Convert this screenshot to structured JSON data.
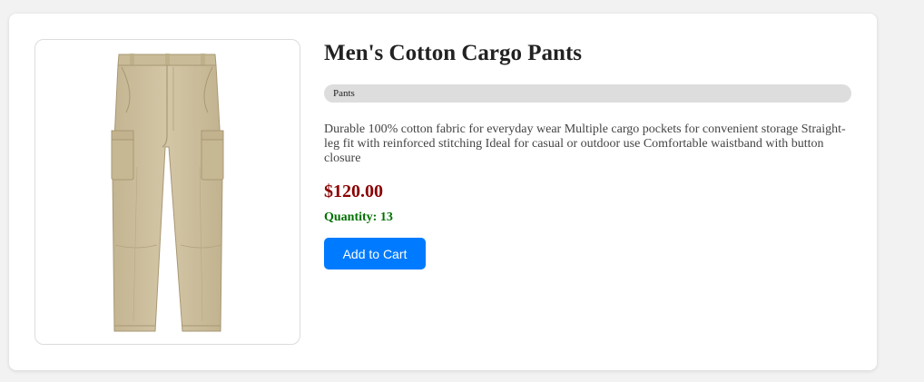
{
  "product": {
    "title": "Men's Cotton Cargo Pants",
    "category": "Pants",
    "description": "Durable 100% cotton fabric for everyday wear Multiple cargo pockets for convenient storage Straight-leg fit with reinforced stitching Ideal for casual or outdoor use Comfortable waistband with button closure",
    "price": "$120.00",
    "quantity": "Quantity: 13",
    "image_icon": "cargo-pants-icon"
  },
  "actions": {
    "add_to_cart_label": "Add to Cart"
  },
  "colors": {
    "price": "#8b0000",
    "quantity": "#007000",
    "button": "#007bff",
    "badge": "#dddddd",
    "pants": "#cdbf9c"
  }
}
